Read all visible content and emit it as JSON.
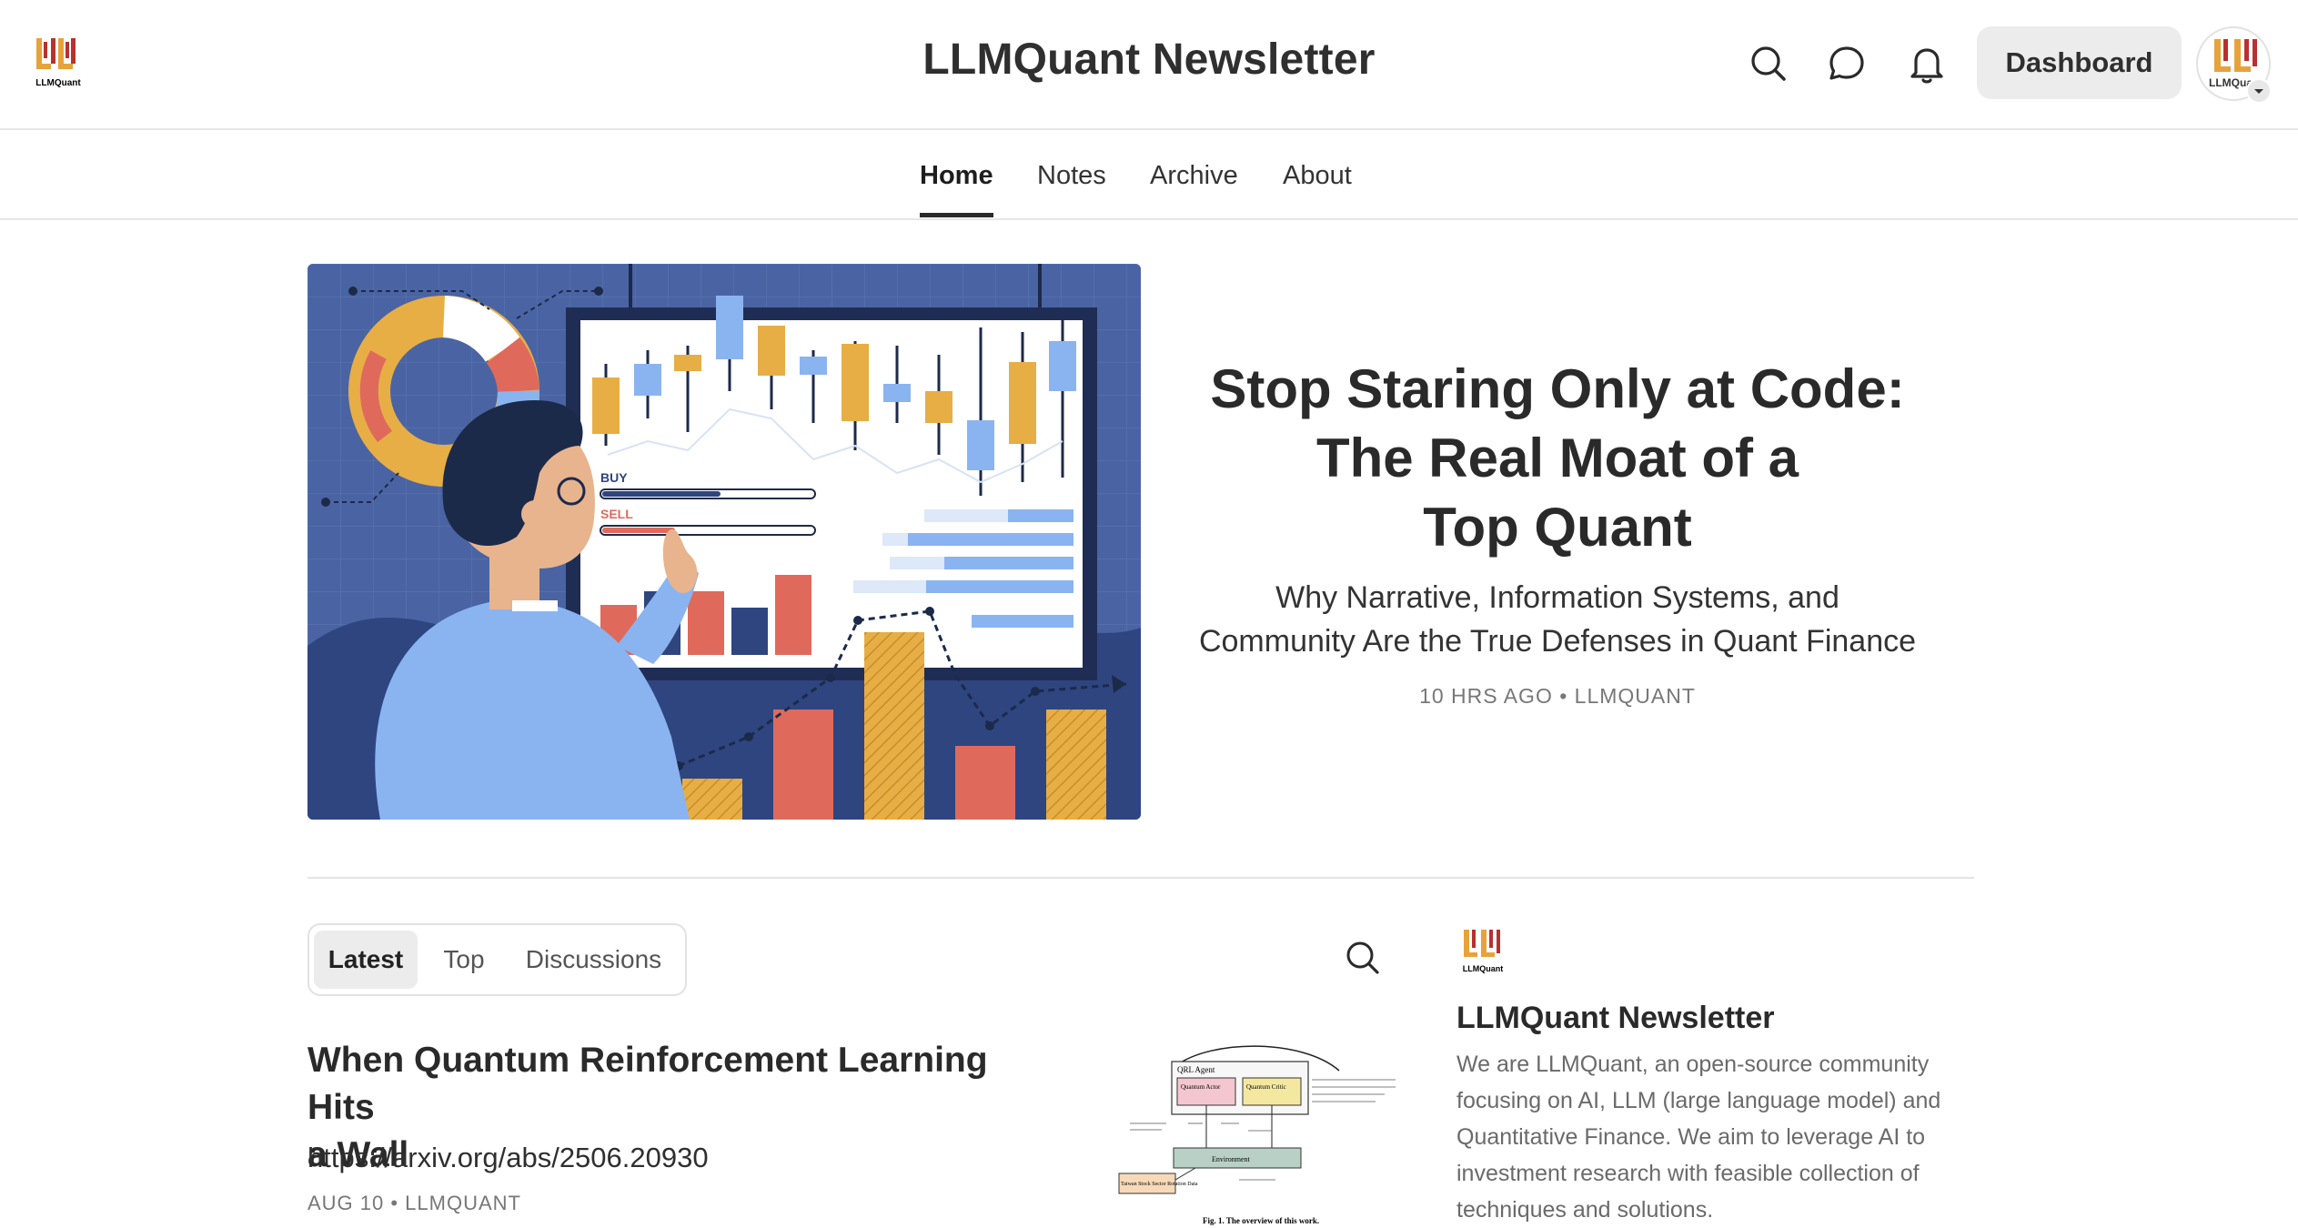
{
  "header": {
    "title": "LLMQuant Newsletter",
    "logo_text": "LLMQuant",
    "dashboard_label": "Dashboard",
    "icons": [
      "search-icon",
      "chat-icon",
      "bell-icon"
    ]
  },
  "nav": {
    "items": [
      {
        "label": "Home"
      },
      {
        "label": "Notes"
      },
      {
        "label": "Archive"
      },
      {
        "label": "About"
      }
    ]
  },
  "hero": {
    "title_line1": "Stop Staring Only at Code:",
    "title_line2": "The Real Moat of a",
    "title_line3": "Top Quant",
    "subtitle_line1": "Why Narrative, Information Systems, and",
    "subtitle_line2": "Community Are the True Defenses in Quant Finance",
    "meta": "10 HRS AGO • LLMQUANT",
    "image_labels": {
      "buy": "BUY",
      "sell": "SELL"
    }
  },
  "feed": {
    "tabs": [
      {
        "label": "Latest"
      },
      {
        "label": "Top"
      },
      {
        "label": "Discussions"
      }
    ],
    "post": {
      "title_line1": "When Quantum Reinforcement Learning Hits",
      "title_line2": "a Wall",
      "url": "https://arxiv.org/abs/2506.20930",
      "meta": "AUG 10 • LLMQUANT",
      "thumb_caption": "Fig. 1.  The overview of this work.",
      "thumb_labels": {
        "agent": "QRL Agent",
        "actor": "Quantum Actor",
        "critic": "Quantum Critic",
        "environment": "Environment",
        "data": "Taiwan Stock Sector Rotation Data"
      }
    }
  },
  "sidebar": {
    "title": "LLMQuant Newsletter",
    "desc_lines": [
      "We are LLMQuant, an open-source community",
      "focusing on AI, LLM (large language model) and",
      "Quantitative Finance. We aim to leverage AI to",
      "investment research with feasible collection of",
      "techniques and solutions."
    ]
  },
  "colors": {
    "logo_orange": "#e8a23a",
    "logo_red": "#b8312f",
    "hero_bg": "#4a64a3",
    "candle_yellow": "#e7ae45",
    "candle_blue": "#8ab4f0",
    "bar_red": "#df6a5c"
  }
}
